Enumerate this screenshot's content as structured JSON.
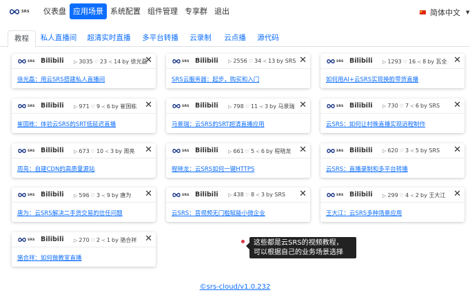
{
  "logo": {
    "text": "SRS"
  },
  "nav": {
    "items": [
      {
        "label": "仪表盘",
        "active": false
      },
      {
        "label": "应用场景",
        "active": true
      },
      {
        "label": "系统配置",
        "active": false
      },
      {
        "label": "组件管理",
        "active": false
      },
      {
        "label": "专享群",
        "active": false
      },
      {
        "label": "退出",
        "active": false
      }
    ],
    "language": "简体中文"
  },
  "tabs": [
    "教程",
    "私人直播间",
    "超清实时直播",
    "多平台转播",
    "云录制",
    "云点播",
    "源代码"
  ],
  "cards": [
    {
      "platform": "Bilibili",
      "views": "3035",
      "likes": "23",
      "shares": "14",
      "author": "by 徐光磊",
      "title": "徐光磊：用云SRS搭建私人直播间"
    },
    {
      "platform": "Bilibili",
      "views": "2556",
      "likes": "34",
      "shares": "13",
      "author": "by SRS",
      "title": "SRS云服务器：起步，购买和入门"
    },
    {
      "platform": "Bilibili",
      "views": "1293",
      "likes": "16",
      "shares": "8",
      "author": "by 瓦全",
      "title": "如何用AI+云SRS实现换脸带货直播"
    },
    {
      "platform": "Bilibili",
      "views": "971",
      "likes": "9",
      "shares": "6",
      "author": "by 崔国栋",
      "title": "崔国栋：体验云SRS的SRT低延迟直播"
    },
    {
      "platform": "Bilibili",
      "views": "798",
      "likes": "11",
      "shares": "3",
      "author": "by 马景瑞",
      "title": "马景瑞：云SRS的SRT超清直播应用"
    },
    {
      "platform": "Bilibili",
      "views": "730",
      "likes": "7",
      "shares": "6",
      "author": "by SRS",
      "title": "云SRS：如何让村晚直播实现远程制作"
    },
    {
      "platform": "Bilibili",
      "views": "673",
      "likes": "10",
      "shares": "3",
      "author": "by 周亮",
      "title": "周亮：自建CDN的高质量源站"
    },
    {
      "platform": "Bilibili",
      "views": "661",
      "likes": "5",
      "shares": "6",
      "author": "by 程晓龙",
      "title": "程晓龙：云SRS如何一键HTTPS"
    },
    {
      "platform": "Bilibili",
      "views": "620",
      "likes": "3",
      "shares": "5",
      "author": "by SRS",
      "title": "云SRS：直播录制和多平台转播"
    },
    {
      "platform": "Bilibili",
      "views": "596",
      "likes": "3",
      "shares": "9",
      "author": "by 唐为",
      "title": "唐为：云SRS解决二手货交易的信任问题"
    },
    {
      "platform": "Bilibili",
      "views": "438",
      "likes": "8",
      "shares": "3",
      "author": "by SRS",
      "title": "云SRS：音视频无门槛赋能小微企业"
    },
    {
      "platform": "Bilibili",
      "views": "299",
      "likes": "4",
      "shares": "2",
      "author": "by 王大江",
      "title": "王大江：云SRS多种场景应用"
    },
    {
      "platform": "Bilibili",
      "views": "270",
      "likes": "2",
      "shares": "1",
      "author": "by 骆合祥",
      "title": "骆合祥：如何做教室直播"
    }
  ],
  "tooltip": {
    "line1": "这些都是云SRS的视频教程，",
    "line2": "可以根据自己的业务场景选择"
  },
  "footer": {
    "text": "©srs-cloud/v1.0.232"
  },
  "colors": {
    "primary": "#0d6efd",
    "tooltip_bg": "#222222",
    "dot": "#dc3545"
  }
}
